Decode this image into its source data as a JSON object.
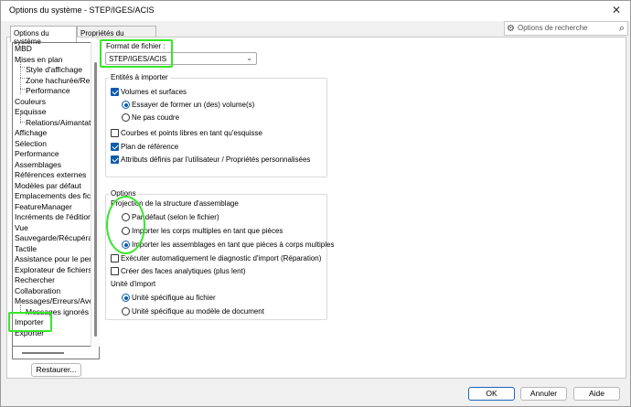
{
  "window": {
    "title": "Options du système - STEP/IGES/ACIS",
    "close_glyph": "✕"
  },
  "tabs": [
    {
      "label": "Options du système"
    },
    {
      "label": "Propriétés du document"
    }
  ],
  "search": {
    "placeholder": "Options de recherche",
    "icon": "gear-icon",
    "search_icon": "search-icon"
  },
  "tree": {
    "items": [
      {
        "label": "MBD"
      },
      {
        "label": "Mises en plan"
      },
      {
        "label": "Style d'affichage"
      },
      {
        "label": "Zone hachurée/Rem"
      },
      {
        "label": "Performance"
      },
      {
        "label": "Couleurs"
      },
      {
        "label": "Esquisse"
      },
      {
        "label": "Relations/Aimantati"
      },
      {
        "label": "Affichage"
      },
      {
        "label": "Sélection"
      },
      {
        "label": "Performance"
      },
      {
        "label": "Assemblages"
      },
      {
        "label": "Références externes"
      },
      {
        "label": "Modèles par défaut"
      },
      {
        "label": "Emplacements des fichi"
      },
      {
        "label": "FeatureManager"
      },
      {
        "label": "Incréments de l'édition d"
      },
      {
        "label": "Vue"
      },
      {
        "label": "Sauvegarde/Récupératio"
      },
      {
        "label": "Tactile"
      },
      {
        "label": "Assistance pour le perça"
      },
      {
        "label": "Explorateur de fichiers"
      },
      {
        "label": "Rechercher"
      },
      {
        "label": "Collaboration"
      },
      {
        "label": "Messages/Erreurs/Avert"
      },
      {
        "label": "Messages ignorés"
      },
      {
        "label": "Importer"
      },
      {
        "label": "Exporter"
      }
    ]
  },
  "buttons": {
    "restore": "Restaurer...",
    "ok": "OK",
    "cancel": "Annuler",
    "help": "Aide"
  },
  "format": {
    "label": "Format de fichier :",
    "value": "STEP/IGES/ACIS"
  },
  "import_entities": {
    "title": "Entités à importer",
    "volumes": "Volumes et surfaces",
    "try_form": "Essayer de former un (des) volume(s)",
    "no_sew": "Ne pas coudre",
    "curves": "Courbes et points libres en tant qu'esquisse",
    "ref_plane": "Plan de référence",
    "attributes": "Attributs définis par l'utilisateur / Propriétés personnalisées"
  },
  "options": {
    "title": "Options",
    "mapping_label": "Projection de la structure d'assemblage",
    "default": "Par défaut (selon le fichier)",
    "import_multibody": "Importer les corps multiples en tant que pièces",
    "import_assemblies": "Importer les assemblages en tant que pièces à corps multiples",
    "run_diagnostics": "Exécuter automatiquement le diagnostic d'import (Réparation)",
    "analytic_faces": "Créer des faces analytiques (plus lent)",
    "unit_label": "Unité d'import",
    "unit_file": "Unité spécifique au fichier",
    "unit_template": "Unité spécifique au modèle de document"
  },
  "state": {
    "volumes_checked": true,
    "curves_checked": false,
    "ref_plane_checked": true,
    "attributes_checked": true,
    "sew_choice": "try_form",
    "mapping_choice": "import_assemblies",
    "run_diagnostics_checked": false,
    "analytic_faces_checked": false,
    "unit_choice": "file"
  },
  "colors": {
    "highlight": "#37e62a",
    "accent": "#0b5cad"
  }
}
